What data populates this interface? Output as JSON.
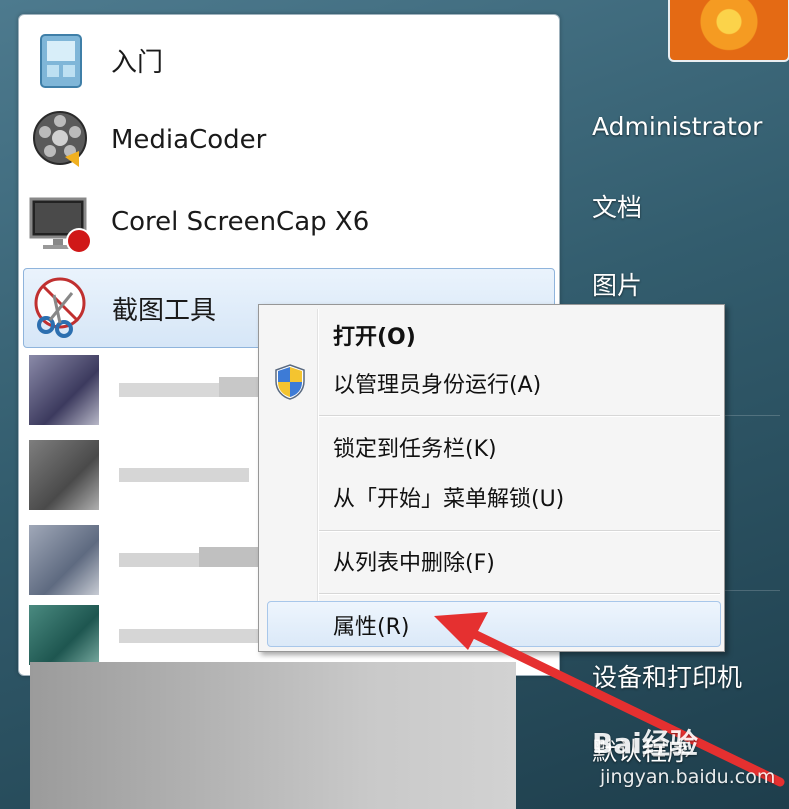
{
  "start_menu": {
    "programs": [
      {
        "label": "入门",
        "icon": "getting-started-icon"
      },
      {
        "label": "MediaCoder",
        "icon": "mediacoder-icon"
      },
      {
        "label": "Corel ScreenCap X6",
        "icon": "screencap-icon"
      },
      {
        "label": "截图工具",
        "icon": "snipping-tool-icon"
      }
    ],
    "right_items": [
      {
        "label": "Administrator"
      },
      {
        "label": "文档"
      },
      {
        "label": "图片"
      },
      {
        "label": "设备和打印机"
      },
      {
        "label": "默认程序"
      }
    ]
  },
  "context_menu": {
    "items": [
      {
        "label": "打开(O)"
      },
      {
        "label": "以管理员身份运行(A)"
      },
      {
        "label": "锁定到任务栏(K)"
      },
      {
        "label": "从「开始」菜单解锁(U)"
      },
      {
        "label": "从列表中删除(F)"
      },
      {
        "label": "属性(R)"
      }
    ]
  },
  "watermark": {
    "brand": "Bai经验",
    "url": "jingyan.baidu.com"
  },
  "colors": {
    "annotation_arrow": "#e53030",
    "highlight_border": "#8fb4dc"
  }
}
